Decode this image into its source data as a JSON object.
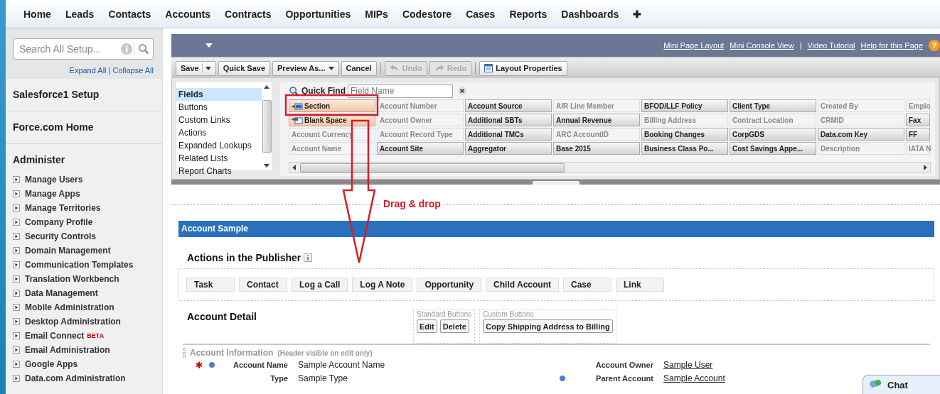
{
  "nav_tabs": [
    {
      "label": "Home"
    },
    {
      "label": "Leads"
    },
    {
      "label": "Contacts"
    },
    {
      "label": "Accounts"
    },
    {
      "label": "Contracts"
    },
    {
      "label": "Opportunities"
    },
    {
      "label": "MIPs"
    },
    {
      "label": "Codestore"
    },
    {
      "label": "Cases"
    },
    {
      "label": "Reports"
    },
    {
      "label": "Dashboards"
    },
    {
      "label": "✚"
    }
  ],
  "sidebar": {
    "search": {
      "placeholder": "Search All Setup..."
    },
    "expand_all": "Expand All",
    "separator": "|",
    "collapse_all": "Collapse All",
    "sections": [
      {
        "title": "Salesforce1 Setup"
      },
      {
        "title": "Force.com Home"
      }
    ],
    "group_title": "Administer",
    "items": [
      {
        "label": "Manage Users",
        "expanded": false
      },
      {
        "label": "Manage Apps",
        "expanded": false
      },
      {
        "label": "Manage Territories",
        "expanded": false
      },
      {
        "label": "Company Profile",
        "expanded": false
      },
      {
        "label": "Security Controls",
        "expanded": false
      },
      {
        "label": "Domain Management",
        "expanded": false
      },
      {
        "label": "Communication Templates",
        "expanded": false
      },
      {
        "label": "Translation Workbench",
        "expanded": false
      },
      {
        "label": "Data Management",
        "expanded": false
      },
      {
        "label": "Mobile Administration",
        "expanded": false
      },
      {
        "label": "Desktop Administration",
        "expanded": false
      },
      {
        "label": "Email Connect",
        "badge": "BETA",
        "expanded": false
      },
      {
        "label": "Email Administration",
        "expanded": false
      },
      {
        "label": "Google Apps",
        "expanded": false
      },
      {
        "label": "Data.com Administration",
        "expanded": false
      }
    ]
  },
  "editor": {
    "help_icon": "?",
    "header_links": [
      {
        "kind": "link",
        "text": "Mini Page Layout"
      },
      {
        "kind": "link",
        "text": "Mini Console View"
      },
      {
        "kind": "separator",
        "text": "|"
      },
      {
        "kind": "link",
        "text": "Video Tutorial"
      },
      {
        "kind": "link",
        "text": "Help for this Page"
      }
    ],
    "toolbar": [
      {
        "kind": "split",
        "label": "Save",
        "disabled": false
      },
      {
        "kind": "button",
        "label": "Quick Save",
        "disabled": false
      },
      {
        "kind": "dropdown",
        "label": "Preview As...",
        "disabled": false
      },
      {
        "kind": "button",
        "label": "Cancel",
        "disabled": false
      },
      {
        "kind": "undo",
        "label": "Undo",
        "disabled": true
      },
      {
        "kind": "redo",
        "label": "Redo",
        "disabled": true
      },
      {
        "kind": "properties",
        "label": "Layout Properties",
        "disabled": false
      }
    ],
    "categories": [
      {
        "label": "Fields",
        "selected": true
      },
      {
        "label": "Buttons",
        "selected": false
      },
      {
        "label": "Custom Links",
        "selected": false
      },
      {
        "label": "Actions",
        "selected": false
      },
      {
        "label": "Expanded Lookups",
        "selected": false
      },
      {
        "label": "Related Lists",
        "selected": false
      },
      {
        "label": "Report Charts",
        "selected": false
      }
    ],
    "quick_find": {
      "label": "Quick Find",
      "placeholder": "Field Name"
    },
    "palette_rows": [
      [
        {
          "kind": "section",
          "label": "Section",
          "used": false
        },
        {
          "kind": "field",
          "label": "Account Number",
          "used": true
        },
        {
          "kind": "field",
          "label": "Account Source",
          "used": false
        },
        {
          "kind": "field",
          "label": "AIR Line Member",
          "used": true
        },
        {
          "kind": "field",
          "label": "BFOD/LLF Policy",
          "used": false
        },
        {
          "kind": "field",
          "label": "Client Type",
          "used": false
        },
        {
          "kind": "field",
          "label": "Created By",
          "used": true
        },
        {
          "kind": "field",
          "label": "Emplo",
          "used": true
        }
      ],
      [
        {
          "kind": "blank",
          "label": "Blank Space",
          "used": false
        },
        {
          "kind": "field",
          "label": "Account Owner",
          "used": true
        },
        {
          "kind": "field",
          "label": "Additional SBTs",
          "used": false
        },
        {
          "kind": "field",
          "label": "Annual Revenue",
          "used": false
        },
        {
          "kind": "field",
          "label": "Billing Address",
          "used": true
        },
        {
          "kind": "field",
          "label": "Contract Location",
          "used": true
        },
        {
          "kind": "field",
          "label": "CRMID",
          "used": true
        },
        {
          "kind": "field",
          "label": "Fax",
          "used": false
        }
      ],
      [
        {
          "kind": "field",
          "label": "Account Currency",
          "used": true
        },
        {
          "kind": "field",
          "label": "Account Record Type",
          "used": true
        },
        {
          "kind": "field",
          "label": "Additional TMCs",
          "used": false
        },
        {
          "kind": "field",
          "label": "ARC AccountID",
          "used": true
        },
        {
          "kind": "field",
          "label": "Booking Changes",
          "used": false
        },
        {
          "kind": "field",
          "label": "CorpGDS",
          "used": false
        },
        {
          "kind": "field",
          "label": "Data.com Key",
          "used": false
        },
        {
          "kind": "field",
          "label": "FF",
          "used": false
        }
      ],
      [
        {
          "kind": "field",
          "label": "Account Name",
          "used": true
        },
        {
          "kind": "field",
          "label": "Account Site",
          "used": false
        },
        {
          "kind": "field",
          "label": "Aggregator",
          "used": false
        },
        {
          "kind": "field",
          "label": "Base 2015",
          "used": false
        },
        {
          "kind": "field",
          "label": "Business Class Po...",
          "used": false
        },
        {
          "kind": "field",
          "label": "Cost Savings Appe...",
          "used": false
        },
        {
          "kind": "field",
          "label": "Description",
          "used": true
        },
        {
          "kind": "field",
          "label": "IATA N",
          "used": true
        }
      ]
    ]
  },
  "annotation": {
    "text": "Drag & drop"
  },
  "layout": {
    "title": "Account Sample",
    "publisher_title": "Actions in the Publisher",
    "actions": [
      {
        "label": "Task"
      },
      {
        "label": "Contact"
      },
      {
        "label": "Log a Call"
      },
      {
        "label": "Log A Note"
      },
      {
        "label": "Opportunity"
      },
      {
        "label": "Child Account"
      },
      {
        "label": "Case"
      },
      {
        "label": "Link"
      }
    ],
    "detail_title": "Account Detail",
    "button_groups": [
      {
        "label": "Standard Buttons",
        "buttons": [
          "Edit",
          "Delete"
        ]
      },
      {
        "label": "Custom Buttons",
        "buttons": [
          "Copy Shipping Address to Billing"
        ]
      }
    ],
    "section_title": "Account Information",
    "section_note": "(Header visible on edit only)",
    "fields": [
      {
        "label": "Account Name",
        "value": "Sample Account Name",
        "required": true,
        "marked": true,
        "link": false
      },
      {
        "label": "Account Owner",
        "value": "Sample User",
        "required": false,
        "marked": false,
        "link": true
      },
      {
        "label": "Type",
        "value": "Sample Type",
        "required": false,
        "marked": false,
        "link": false
      },
      {
        "label": "Parent Account",
        "value": "Sample Account",
        "required": false,
        "marked": true,
        "link": true
      }
    ]
  },
  "chat": {
    "label": "Chat"
  }
}
